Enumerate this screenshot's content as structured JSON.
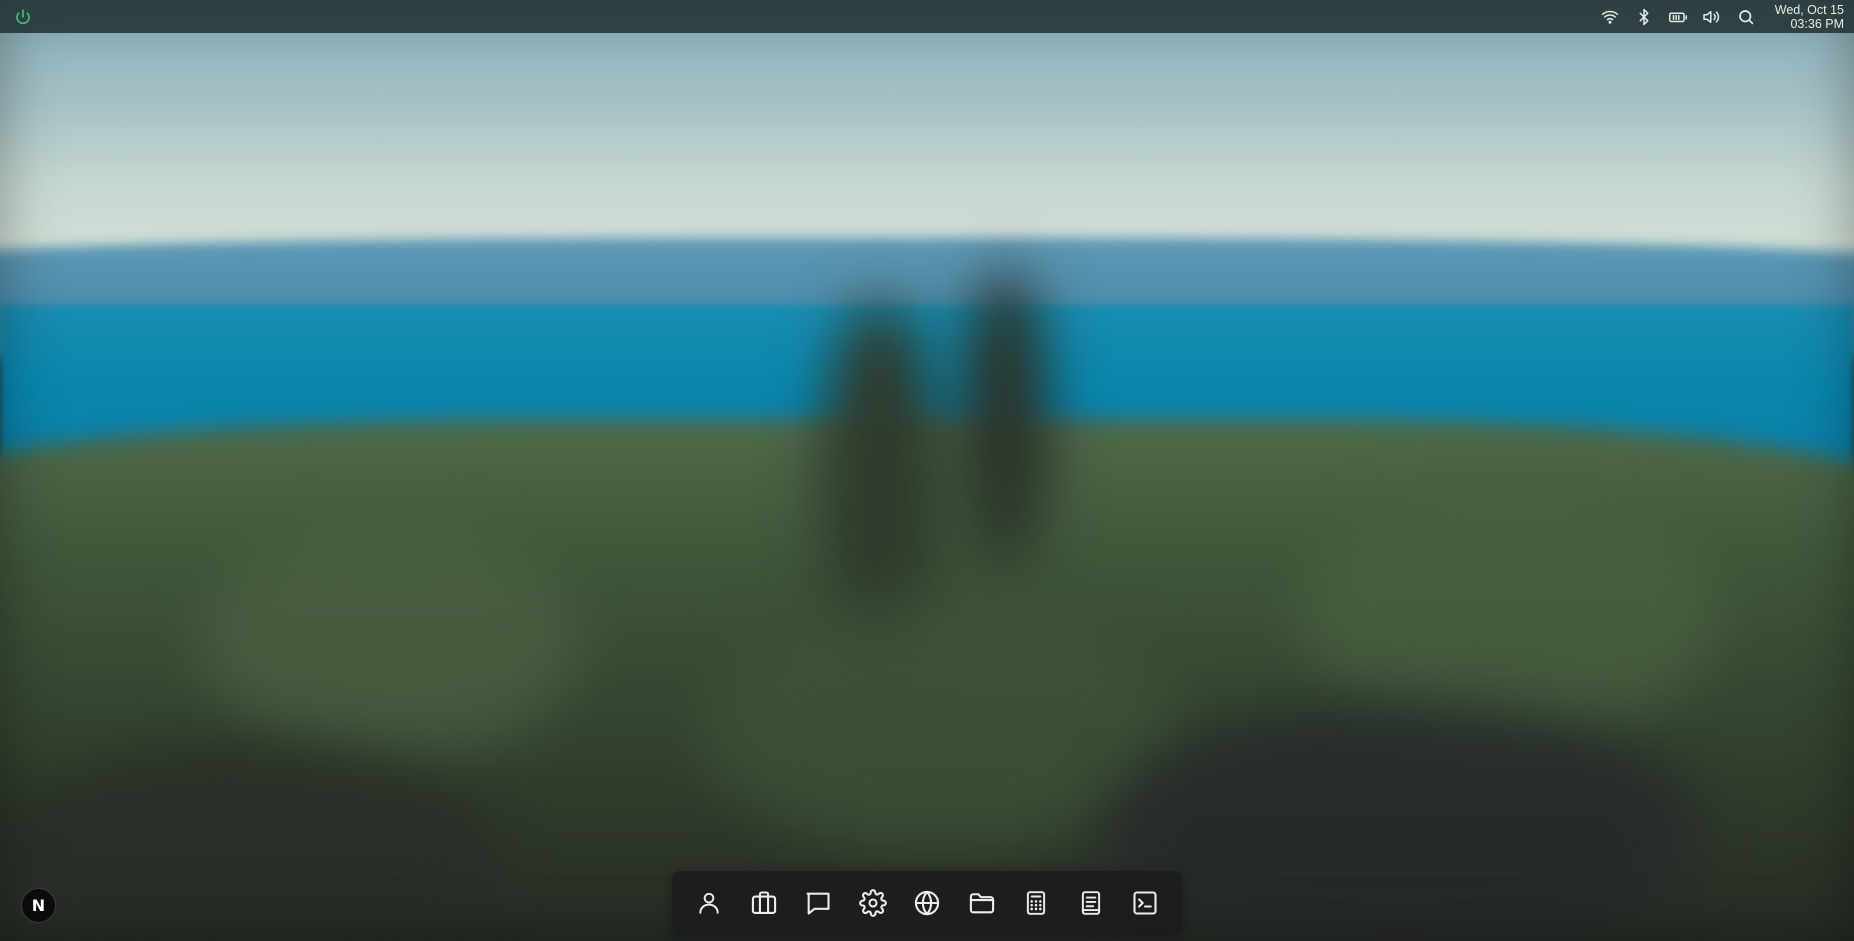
{
  "desktop": {
    "wallpaper": "blurred-lake-forest",
    "accent_color": "#3fbf7f"
  },
  "topbar": {
    "power_icon": "power-icon",
    "tray": [
      {
        "name": "wifi-icon"
      },
      {
        "name": "bluetooth-icon"
      },
      {
        "name": "battery-icon"
      },
      {
        "name": "volume-icon"
      },
      {
        "name": "search-icon"
      }
    ],
    "clock": {
      "date": "Wed, Oct 15",
      "time": "03:36 PM"
    }
  },
  "corner_launcher": {
    "label": "N",
    "icon": "n-logo-icon"
  },
  "dock": {
    "items": [
      {
        "name": "person-icon"
      },
      {
        "name": "briefcase-icon"
      },
      {
        "name": "chat-icon"
      },
      {
        "name": "gear-icon"
      },
      {
        "name": "globe-icon"
      },
      {
        "name": "folder-icon"
      },
      {
        "name": "calculator-icon"
      },
      {
        "name": "document-icon"
      },
      {
        "name": "terminal-icon"
      }
    ]
  }
}
